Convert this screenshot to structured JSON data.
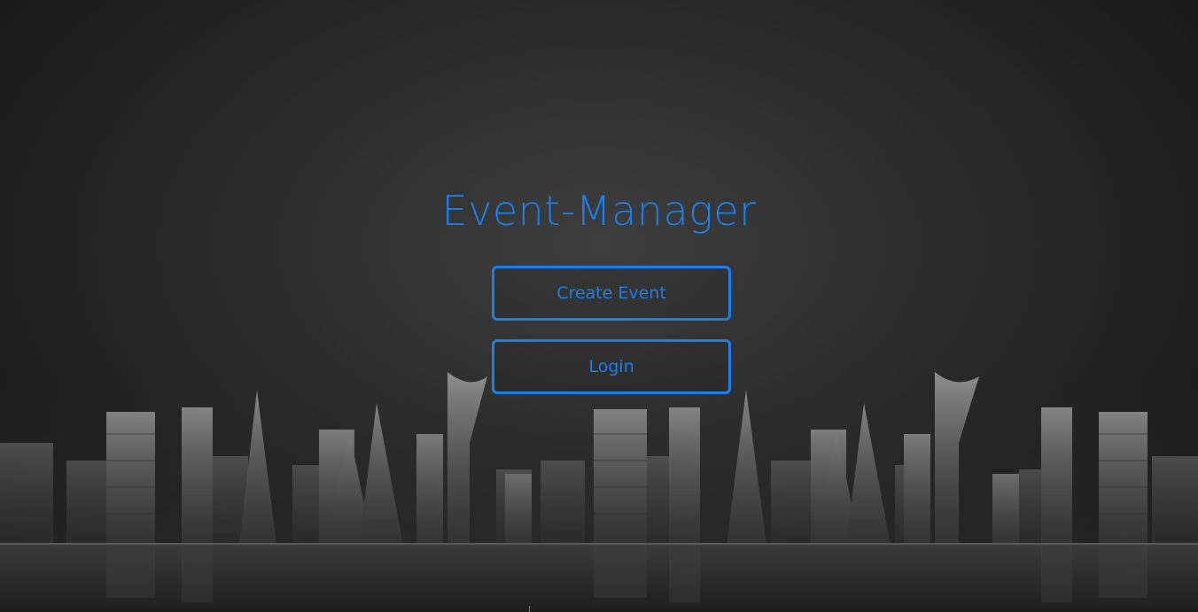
{
  "app": {
    "title": "Event-Manager"
  },
  "actions": {
    "create_event_label": "Create Event",
    "login_label": "Login"
  },
  "colors": {
    "accent": "#1a7fe8",
    "background": "#2a2a2a"
  }
}
